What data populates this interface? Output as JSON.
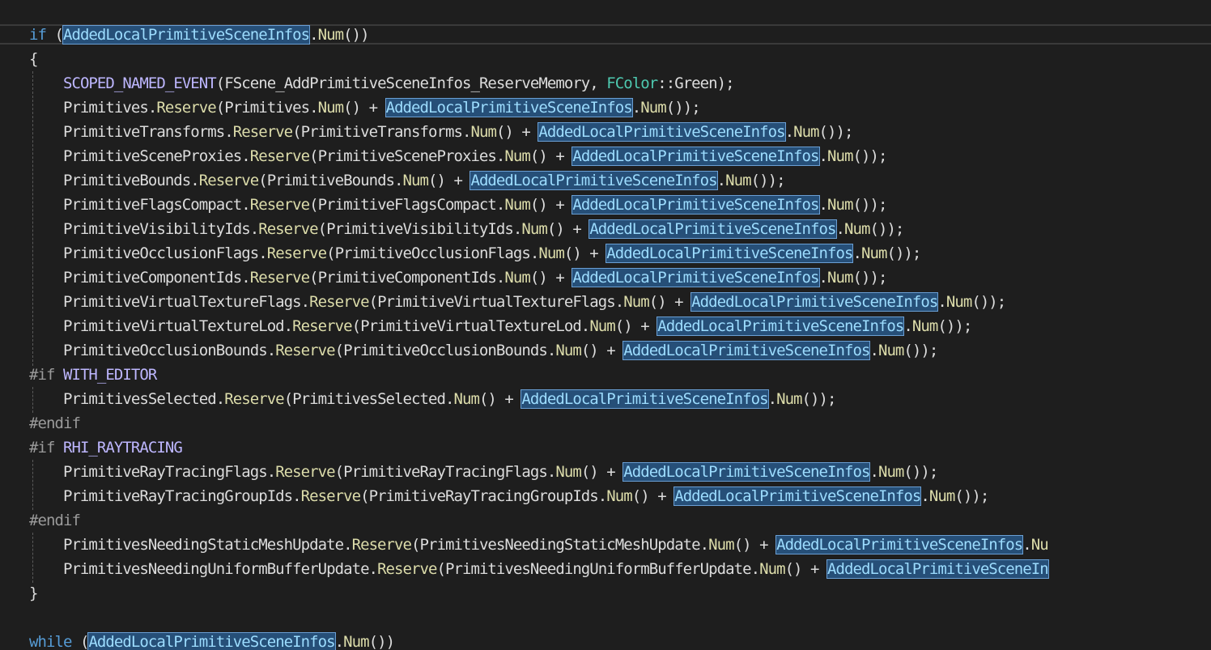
{
  "lines": [
    [
      {
        "t": "if",
        "c": "kw"
      },
      {
        "t": " (",
        "c": "id"
      },
      {
        "t": "AddedLocalPrimitiveSceneInfos",
        "c": "hl"
      },
      {
        "t": ".",
        "c": "id"
      },
      {
        "t": "Num",
        "c": "fn"
      },
      {
        "t": "())",
        "c": "id"
      }
    ],
    [
      {
        "t": "{",
        "c": "id"
      }
    ],
    [
      {
        "t": "    ",
        "c": "id"
      },
      {
        "t": "SCOPED_NAMED_EVENT",
        "c": "mac"
      },
      {
        "t": "(FScene_AddPrimitiveSceneInfos_ReserveMemory, ",
        "c": "id"
      },
      {
        "t": "FColor",
        "c": "ty"
      },
      {
        "t": "::Green);",
        "c": "id"
      }
    ],
    [
      {
        "t": "    Primitives.",
        "c": "id"
      },
      {
        "t": "Reserve",
        "c": "fn"
      },
      {
        "t": "(Primitives.",
        "c": "id"
      },
      {
        "t": "Num",
        "c": "fn"
      },
      {
        "t": "() + ",
        "c": "id"
      },
      {
        "t": "AddedLocalPrimitiveSceneInfos",
        "c": "hl"
      },
      {
        "t": ".",
        "c": "id"
      },
      {
        "t": "Num",
        "c": "fn"
      },
      {
        "t": "());",
        "c": "id"
      }
    ],
    [
      {
        "t": "    PrimitiveTransforms.",
        "c": "id"
      },
      {
        "t": "Reserve",
        "c": "fn"
      },
      {
        "t": "(PrimitiveTransforms.",
        "c": "id"
      },
      {
        "t": "Num",
        "c": "fn"
      },
      {
        "t": "() + ",
        "c": "id"
      },
      {
        "t": "AddedLocalPrimitiveSceneInfos",
        "c": "hl"
      },
      {
        "t": ".",
        "c": "id"
      },
      {
        "t": "Num",
        "c": "fn"
      },
      {
        "t": "());",
        "c": "id"
      }
    ],
    [
      {
        "t": "    PrimitiveSceneProxies.",
        "c": "id"
      },
      {
        "t": "Reserve",
        "c": "fn"
      },
      {
        "t": "(PrimitiveSceneProxies.",
        "c": "id"
      },
      {
        "t": "Num",
        "c": "fn"
      },
      {
        "t": "() + ",
        "c": "id"
      },
      {
        "t": "AddedLocalPrimitiveSceneInfos",
        "c": "hl"
      },
      {
        "t": ".",
        "c": "id"
      },
      {
        "t": "Num",
        "c": "fn"
      },
      {
        "t": "());",
        "c": "id"
      }
    ],
    [
      {
        "t": "    PrimitiveBounds.",
        "c": "id"
      },
      {
        "t": "Reserve",
        "c": "fn"
      },
      {
        "t": "(PrimitiveBounds.",
        "c": "id"
      },
      {
        "t": "Num",
        "c": "fn"
      },
      {
        "t": "() + ",
        "c": "id"
      },
      {
        "t": "AddedLocalPrimitiveSceneInfos",
        "c": "hl"
      },
      {
        "t": ".",
        "c": "id"
      },
      {
        "t": "Num",
        "c": "fn"
      },
      {
        "t": "());",
        "c": "id"
      }
    ],
    [
      {
        "t": "    PrimitiveFlagsCompact.",
        "c": "id"
      },
      {
        "t": "Reserve",
        "c": "fn"
      },
      {
        "t": "(PrimitiveFlagsCompact.",
        "c": "id"
      },
      {
        "t": "Num",
        "c": "fn"
      },
      {
        "t": "() + ",
        "c": "id"
      },
      {
        "t": "AddedLocalPrimitiveSceneInfos",
        "c": "hl"
      },
      {
        "t": ".",
        "c": "id"
      },
      {
        "t": "Num",
        "c": "fn"
      },
      {
        "t": "());",
        "c": "id"
      }
    ],
    [
      {
        "t": "    PrimitiveVisibilityIds.",
        "c": "id"
      },
      {
        "t": "Reserve",
        "c": "fn"
      },
      {
        "t": "(PrimitiveVisibilityIds.",
        "c": "id"
      },
      {
        "t": "Num",
        "c": "fn"
      },
      {
        "t": "() + ",
        "c": "id"
      },
      {
        "t": "AddedLocalPrimitiveSceneInfos",
        "c": "hl"
      },
      {
        "t": ".",
        "c": "id"
      },
      {
        "t": "Num",
        "c": "fn"
      },
      {
        "t": "());",
        "c": "id"
      }
    ],
    [
      {
        "t": "    PrimitiveOcclusionFlags.",
        "c": "id"
      },
      {
        "t": "Reserve",
        "c": "fn"
      },
      {
        "t": "(PrimitiveOcclusionFlags.",
        "c": "id"
      },
      {
        "t": "Num",
        "c": "fn"
      },
      {
        "t": "() + ",
        "c": "id"
      },
      {
        "t": "AddedLocalPrimitiveSceneInfos",
        "c": "hl"
      },
      {
        "t": ".",
        "c": "id"
      },
      {
        "t": "Num",
        "c": "fn"
      },
      {
        "t": "());",
        "c": "id"
      }
    ],
    [
      {
        "t": "    PrimitiveComponentIds.",
        "c": "id"
      },
      {
        "t": "Reserve",
        "c": "fn"
      },
      {
        "t": "(PrimitiveComponentIds.",
        "c": "id"
      },
      {
        "t": "Num",
        "c": "fn"
      },
      {
        "t": "() + ",
        "c": "id"
      },
      {
        "t": "AddedLocalPrimitiveSceneInfos",
        "c": "hl"
      },
      {
        "t": ".",
        "c": "id"
      },
      {
        "t": "Num",
        "c": "fn"
      },
      {
        "t": "());",
        "c": "id"
      }
    ],
    [
      {
        "t": "    PrimitiveVirtualTextureFlags.",
        "c": "id"
      },
      {
        "t": "Reserve",
        "c": "fn"
      },
      {
        "t": "(PrimitiveVirtualTextureFlags.",
        "c": "id"
      },
      {
        "t": "Num",
        "c": "fn"
      },
      {
        "t": "() + ",
        "c": "id"
      },
      {
        "t": "AddedLocalPrimitiveSceneInfos",
        "c": "hl"
      },
      {
        "t": ".",
        "c": "id"
      },
      {
        "t": "Num",
        "c": "fn"
      },
      {
        "t": "());",
        "c": "id"
      }
    ],
    [
      {
        "t": "    PrimitiveVirtualTextureLod.",
        "c": "id"
      },
      {
        "t": "Reserve",
        "c": "fn"
      },
      {
        "t": "(PrimitiveVirtualTextureLod.",
        "c": "id"
      },
      {
        "t": "Num",
        "c": "fn"
      },
      {
        "t": "() + ",
        "c": "id"
      },
      {
        "t": "AddedLocalPrimitiveSceneInfos",
        "c": "hl"
      },
      {
        "t": ".",
        "c": "id"
      },
      {
        "t": "Num",
        "c": "fn"
      },
      {
        "t": "());",
        "c": "id"
      }
    ],
    [
      {
        "t": "    PrimitiveOcclusionBounds.",
        "c": "id"
      },
      {
        "t": "Reserve",
        "c": "fn"
      },
      {
        "t": "(PrimitiveOcclusionBounds.",
        "c": "id"
      },
      {
        "t": "Num",
        "c": "fn"
      },
      {
        "t": "() + ",
        "c": "id"
      },
      {
        "t": "AddedLocalPrimitiveSceneInfos",
        "c": "hl"
      },
      {
        "t": ".",
        "c": "id"
      },
      {
        "t": "Num",
        "c": "fn"
      },
      {
        "t": "());",
        "c": "id"
      }
    ],
    [
      {
        "t": "#if ",
        "c": "pre"
      },
      {
        "t": "WITH_EDITOR",
        "c": "mac"
      }
    ],
    [
      {
        "t": "    PrimitivesSelected.",
        "c": "id"
      },
      {
        "t": "Reserve",
        "c": "fn"
      },
      {
        "t": "(PrimitivesSelected.",
        "c": "id"
      },
      {
        "t": "Num",
        "c": "fn"
      },
      {
        "t": "() + ",
        "c": "id"
      },
      {
        "t": "AddedLocalPrimitiveSceneInfos",
        "c": "hl"
      },
      {
        "t": ".",
        "c": "id"
      },
      {
        "t": "Num",
        "c": "fn"
      },
      {
        "t": "());",
        "c": "id"
      }
    ],
    [
      {
        "t": "#endif",
        "c": "pre"
      }
    ],
    [
      {
        "t": "#if ",
        "c": "pre"
      },
      {
        "t": "RHI_RAYTRACING",
        "c": "mac"
      }
    ],
    [
      {
        "t": "    PrimitiveRayTracingFlags.",
        "c": "id"
      },
      {
        "t": "Reserve",
        "c": "fn"
      },
      {
        "t": "(PrimitiveRayTracingFlags.",
        "c": "id"
      },
      {
        "t": "Num",
        "c": "fn"
      },
      {
        "t": "() + ",
        "c": "id"
      },
      {
        "t": "AddedLocalPrimitiveSceneInfos",
        "c": "hl"
      },
      {
        "t": ".",
        "c": "id"
      },
      {
        "t": "Num",
        "c": "fn"
      },
      {
        "t": "());",
        "c": "id"
      }
    ],
    [
      {
        "t": "    PrimitiveRayTracingGroupIds.",
        "c": "id"
      },
      {
        "t": "Reserve",
        "c": "fn"
      },
      {
        "t": "(PrimitiveRayTracingGroupIds.",
        "c": "id"
      },
      {
        "t": "Num",
        "c": "fn"
      },
      {
        "t": "() + ",
        "c": "id"
      },
      {
        "t": "AddedLocalPrimitiveSceneInfos",
        "c": "hl"
      },
      {
        "t": ".",
        "c": "id"
      },
      {
        "t": "Num",
        "c": "fn"
      },
      {
        "t": "());",
        "c": "id"
      }
    ],
    [
      {
        "t": "#endif",
        "c": "pre"
      }
    ],
    [
      {
        "t": "    PrimitivesNeedingStaticMeshUpdate.",
        "c": "id"
      },
      {
        "t": "Reserve",
        "c": "fn"
      },
      {
        "t": "(PrimitivesNeedingStaticMeshUpdate.",
        "c": "id"
      },
      {
        "t": "Num",
        "c": "fn"
      },
      {
        "t": "() + ",
        "c": "id"
      },
      {
        "t": "AddedLocalPrimitiveSceneInfos",
        "c": "hl"
      },
      {
        "t": ".",
        "c": "id"
      },
      {
        "t": "Nu",
        "c": "fn"
      }
    ],
    [
      {
        "t": "    PrimitivesNeedingUniformBufferUpdate.",
        "c": "id"
      },
      {
        "t": "Reserve",
        "c": "fn"
      },
      {
        "t": "(PrimitivesNeedingUniformBufferUpdate.",
        "c": "id"
      },
      {
        "t": "Num",
        "c": "fn"
      },
      {
        "t": "() + ",
        "c": "id"
      },
      {
        "t": "AddedLocalPrimitiveSceneIn",
        "c": "hl"
      }
    ],
    [
      {
        "t": "}",
        "c": "id"
      }
    ],
    [],
    [
      {
        "t": "while",
        "c": "kw"
      },
      {
        "t": " (",
        "c": "id"
      },
      {
        "t": "AddedLocalPrimitiveSceneInfos",
        "c": "hl"
      },
      {
        "t": ".",
        "c": "id"
      },
      {
        "t": "Num",
        "c": "fn"
      },
      {
        "t": "())",
        "c": "id"
      }
    ]
  ]
}
